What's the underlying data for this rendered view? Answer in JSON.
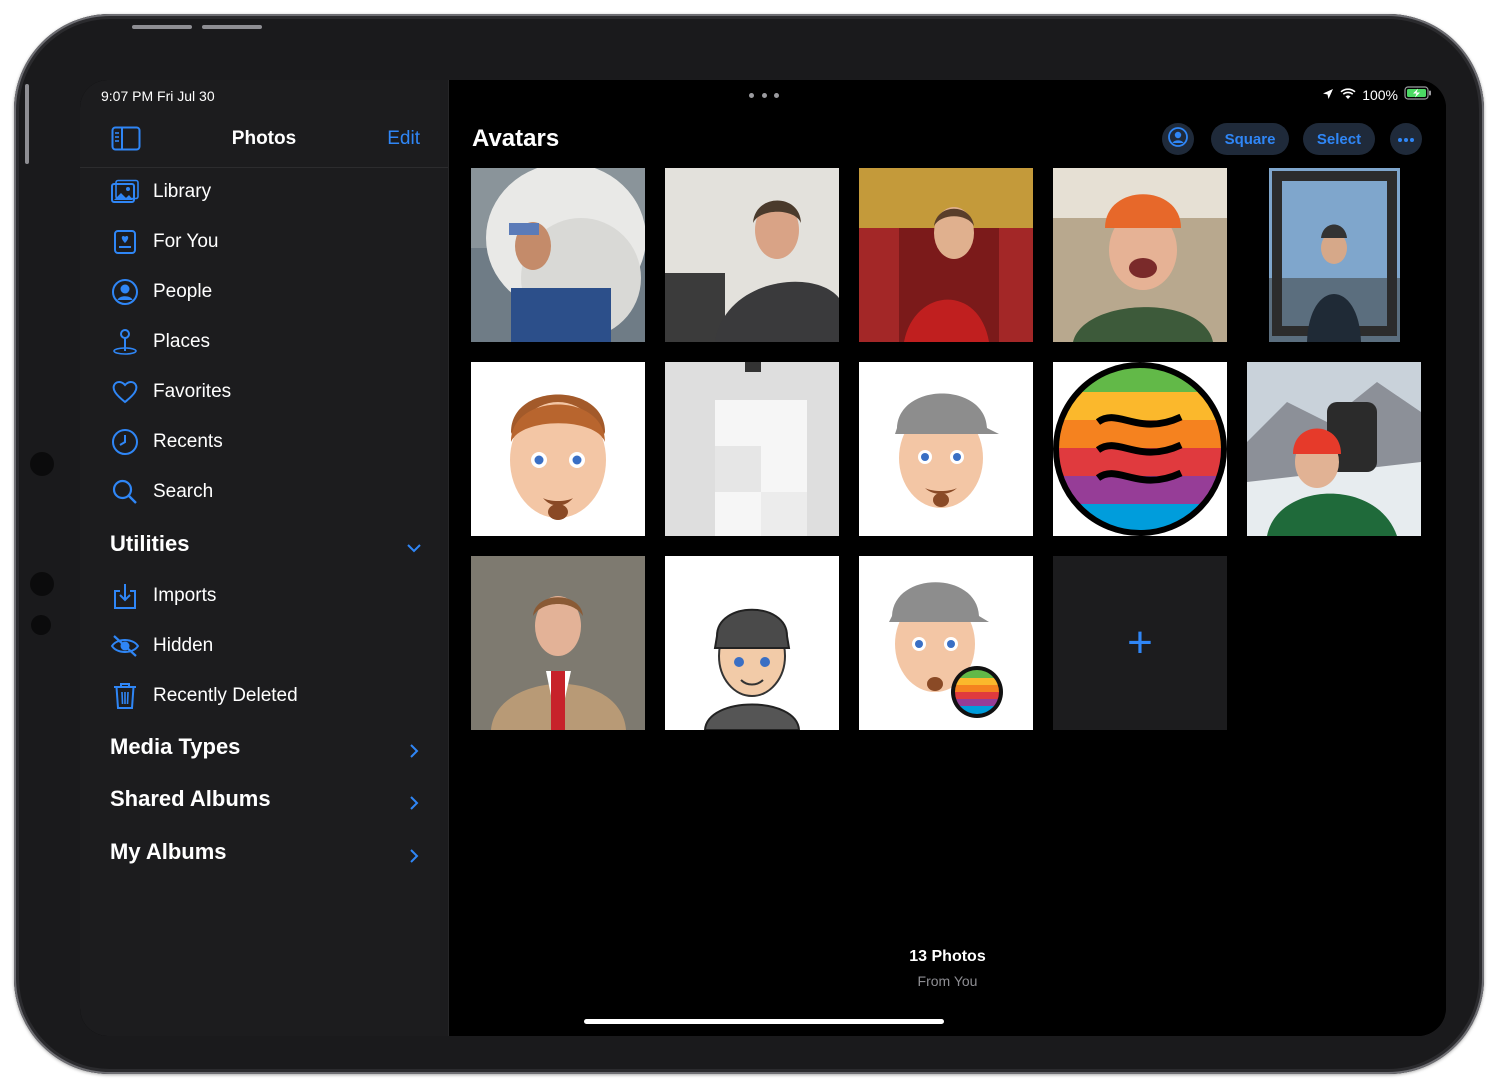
{
  "status": {
    "time": "9:07 PM   Fri Jul 30",
    "battery": "100%"
  },
  "sidebar": {
    "title": "Photos",
    "edit_label": "Edit",
    "items": [
      {
        "label": "Library",
        "icon": "photo-library-icon"
      },
      {
        "label": "For You",
        "icon": "for-you-icon"
      },
      {
        "label": "People",
        "icon": "person-circle-icon"
      },
      {
        "label": "Places",
        "icon": "map-pin-icon"
      },
      {
        "label": "Favorites",
        "icon": "heart-icon"
      },
      {
        "label": "Recents",
        "icon": "clock-icon"
      },
      {
        "label": "Search",
        "icon": "search-icon"
      }
    ],
    "utilities": {
      "label": "Utilities",
      "items": [
        {
          "label": "Imports",
          "icon": "import-icon"
        },
        {
          "label": "Hidden",
          "icon": "eye-slash-icon"
        },
        {
          "label": "Recently Deleted",
          "icon": "trash-icon"
        }
      ]
    },
    "sections": [
      {
        "label": "Media Types"
      },
      {
        "label": "Shared Albums"
      },
      {
        "label": "My Albums"
      }
    ]
  },
  "main": {
    "title": "Avatars",
    "buttons": {
      "square": "Square",
      "select": "Select"
    },
    "add_label": "+",
    "footer": {
      "count": "13 Photos",
      "source": "From You"
    }
  },
  "colors": {
    "accent": "#2f86f6",
    "sidebar_bg": "#1c1c1e",
    "main_bg": "#000000"
  }
}
